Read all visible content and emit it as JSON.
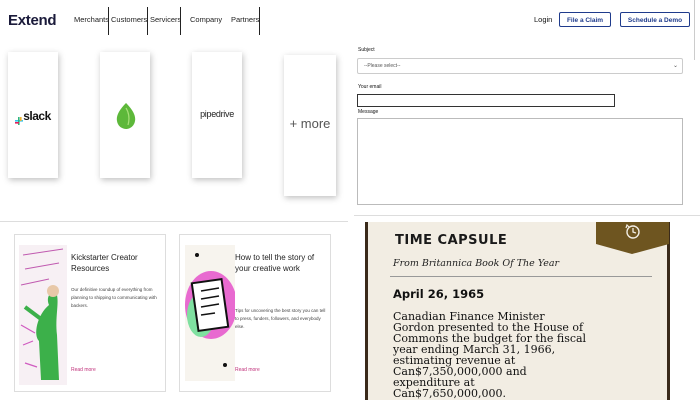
{
  "header": {
    "logo": "Extend",
    "nav": [
      "Merchants",
      "Customers",
      "Servicers",
      "Company",
      "Partners"
    ],
    "login": "Login",
    "file_claim": "File a Claim",
    "schedule_demo": "Schedule a Demo"
  },
  "integrations": {
    "slack": "slack",
    "pipedrive": "pipedrive",
    "more": "+ more"
  },
  "form": {
    "subject_label": "Subject",
    "subject_value": "--Please select--",
    "email_label": "Your email",
    "message_label": "Message"
  },
  "articles": [
    {
      "title": "Kickstarter Creator Resources",
      "desc": "Our definitive roundup of everything from planning to shipping to communicating with backers.",
      "more": "Read more"
    },
    {
      "title": "How to tell the story of your creative work",
      "desc": "Tips for uncovering the best story you can tell to press, funders, followers, and everybody else.",
      "more": "Read more"
    }
  ],
  "time_capsule": {
    "title": "TIME CAPSULE",
    "subtitle": "From Britannica Book Of The Year",
    "date": "April 26, 1965",
    "body": [
      "Canadian Finance Minister",
      "Gordon presented to the House of",
      "Commons the budget for the fiscal",
      "year ending March 31, 1966,",
      "estimating revenue at",
      "Can$7,350,000,000 and",
      "expenditure at",
      "Can$7,650,000,000."
    ]
  },
  "colors": {
    "brand": "#1f3b8c",
    "link": "#c0307a",
    "slack_green": "#5db83a",
    "badge": "#6e5520"
  }
}
